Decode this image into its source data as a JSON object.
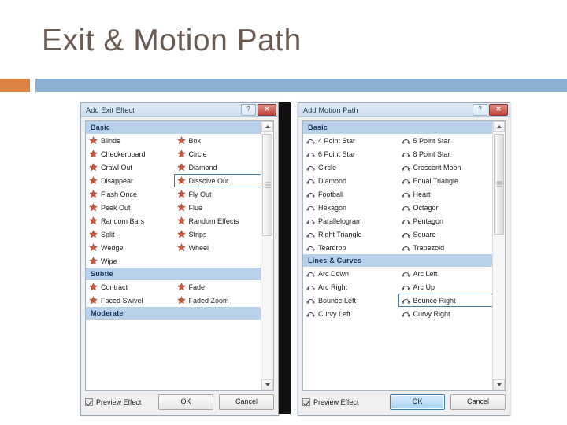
{
  "slide": {
    "title": "Exit & Motion Path",
    "accent_orange": "#dd8245",
    "accent_blue": "#8cb0d3",
    "title_color": "#6b5b52"
  },
  "exit_dialog": {
    "title": "Add Exit Effect",
    "help_label": "?",
    "close_label": "✕",
    "icon_color": "#c8553d",
    "groups": [
      {
        "name": "Basic",
        "rows": [
          [
            "Blinds",
            "Box"
          ],
          [
            "Checkerboard",
            "Circle"
          ],
          [
            "Crawl Out",
            "Diamond"
          ],
          [
            "Disappear",
            "Dissolve Out"
          ],
          [
            "Flash Once",
            "Fly Out"
          ],
          [
            "Peek Out",
            "Flue"
          ],
          [
            "Random Bars",
            "Random Effects"
          ],
          [
            "Split",
            "Strips"
          ],
          [
            "Wedge",
            "Wheel"
          ],
          [
            "Wipe",
            ""
          ]
        ]
      },
      {
        "name": "Subtle",
        "rows": [
          [
            "Contract",
            "Fade"
          ],
          [
            "Faced Swivel",
            "Faded Zoom"
          ]
        ]
      },
      {
        "name": "Moderate",
        "rows": []
      }
    ],
    "selected": "Dissolve Out",
    "footer": {
      "preview_label": "Preview Effect",
      "preview_checked": true,
      "ok_label": "OK",
      "cancel_label": "Cancel",
      "ok_focused": false
    }
  },
  "motion_dialog": {
    "title": "Add Motion Path",
    "help_label": "?",
    "close_label": "✕",
    "icon_color": "#3a3a3a",
    "groups": [
      {
        "name": "Basic",
        "rows": [
          [
            "4 Point Star",
            "5 Point Star"
          ],
          [
            "6 Point Star",
            "8 Point Star"
          ],
          [
            "Circle",
            "Crescent Moon"
          ],
          [
            "Diamond",
            "Equal Triangle"
          ],
          [
            "Football",
            "Heart"
          ],
          [
            "Hexagon",
            "Octagon"
          ],
          [
            "Parallelogram",
            "Pentagon"
          ],
          [
            "Right Triangle",
            "Square"
          ],
          [
            "Teardrop",
            "Trapezoid"
          ]
        ]
      },
      {
        "name": "Lines & Curves",
        "rows": [
          [
            "Arc Down",
            "Arc Left"
          ],
          [
            "Arc Right",
            "Arc Up"
          ],
          [
            "Bounce Left",
            "Bounce Right"
          ],
          [
            "Curvy Left",
            "Curvy Right"
          ]
        ]
      }
    ],
    "selected": "Bounce Right",
    "footer": {
      "preview_label": "Preview Effect",
      "preview_checked": true,
      "ok_label": "OK",
      "cancel_label": "Cancel",
      "ok_focused": true
    }
  }
}
